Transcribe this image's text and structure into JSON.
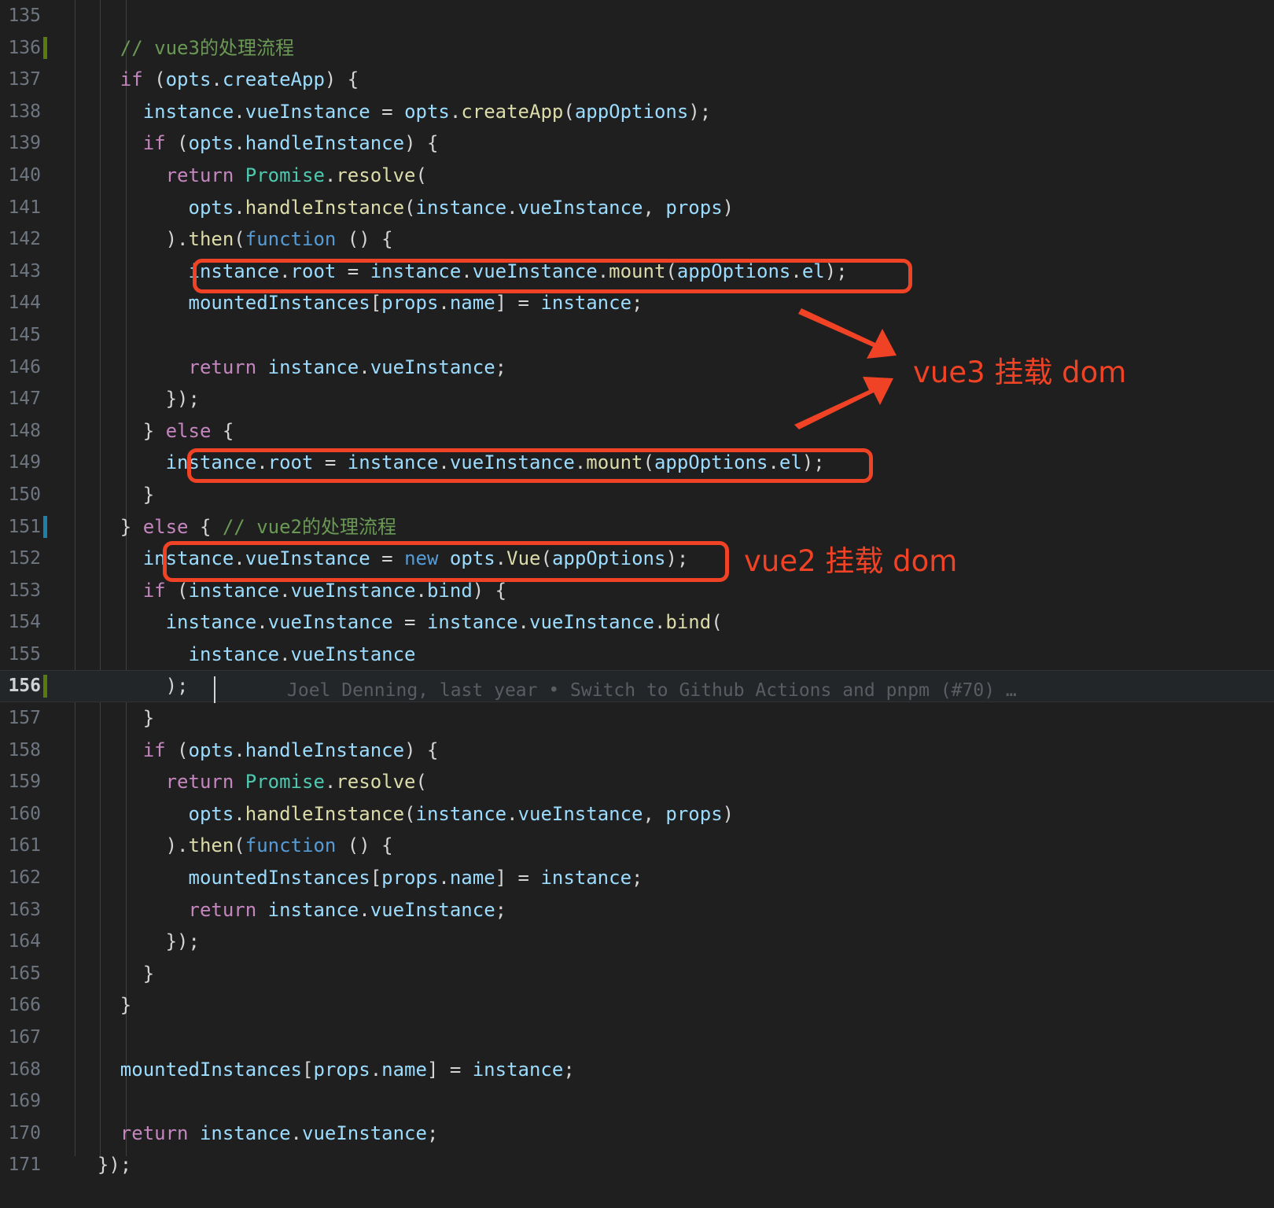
{
  "editor": {
    "theme": "dark-plus",
    "background": "#1f1f1f",
    "active_line_background": "#232629",
    "line_number_color": "#6e7681",
    "first_line": 135,
    "last_line": 171,
    "active_line": 156
  },
  "line_numbers": [
    "135",
    "136",
    "137",
    "138",
    "139",
    "140",
    "141",
    "142",
    "143",
    "144",
    "145",
    "146",
    "147",
    "148",
    "149",
    "150",
    "151",
    "152",
    "153",
    "154",
    "155",
    "156",
    "157",
    "158",
    "159",
    "160",
    "161",
    "162",
    "163",
    "164",
    "165",
    "166",
    "167",
    "168",
    "169",
    "170",
    "171"
  ],
  "code_lines": [
    {
      "n": "135",
      "text": ""
    },
    {
      "n": "136",
      "text": "    // vue3的处理流程"
    },
    {
      "n": "137",
      "text": "    if (opts.createApp) {"
    },
    {
      "n": "138",
      "text": "      instance.vueInstance = opts.createApp(appOptions);"
    },
    {
      "n": "139",
      "text": "      if (opts.handleInstance) {"
    },
    {
      "n": "140",
      "text": "        return Promise.resolve("
    },
    {
      "n": "141",
      "text": "          opts.handleInstance(instance.vueInstance, props)"
    },
    {
      "n": "142",
      "text": "        ).then(function () {"
    },
    {
      "n": "143",
      "text": "          instance.root = instance.vueInstance.mount(appOptions.el);"
    },
    {
      "n": "144",
      "text": "          mountedInstances[props.name] = instance;"
    },
    {
      "n": "145",
      "text": ""
    },
    {
      "n": "146",
      "text": "          return instance.vueInstance;"
    },
    {
      "n": "147",
      "text": "        });"
    },
    {
      "n": "148",
      "text": "      } else {"
    },
    {
      "n": "149",
      "text": "        instance.root = instance.vueInstance.mount(appOptions.el);"
    },
    {
      "n": "150",
      "text": "      }"
    },
    {
      "n": "151",
      "text": "    } else { // vue2的处理流程"
    },
    {
      "n": "152",
      "text": "      instance.vueInstance = new opts.Vue(appOptions);"
    },
    {
      "n": "153",
      "text": "      if (instance.vueInstance.bind) {"
    },
    {
      "n": "154",
      "text": "        instance.vueInstance = instance.vueInstance.bind("
    },
    {
      "n": "155",
      "text": "          instance.vueInstance"
    },
    {
      "n": "156",
      "text": "        );"
    },
    {
      "n": "157",
      "text": "      }"
    },
    {
      "n": "158",
      "text": "      if (opts.handleInstance) {"
    },
    {
      "n": "159",
      "text": "        return Promise.resolve("
    },
    {
      "n": "160",
      "text": "          opts.handleInstance(instance.vueInstance, props)"
    },
    {
      "n": "161",
      "text": "        ).then(function () {"
    },
    {
      "n": "162",
      "text": "          mountedInstances[props.name] = instance;"
    },
    {
      "n": "163",
      "text": "          return instance.vueInstance;"
    },
    {
      "n": "164",
      "text": "        });"
    },
    {
      "n": "165",
      "text": "      }"
    },
    {
      "n": "166",
      "text": "    }"
    },
    {
      "n": "167",
      "text": ""
    },
    {
      "n": "168",
      "text": "    mountedInstances[props.name] = instance;"
    },
    {
      "n": "169",
      "text": ""
    },
    {
      "n": "170",
      "text": "    return instance.vueInstance;"
    },
    {
      "n": "171",
      "text": "  });"
    }
  ],
  "tokens": {
    "l136": [
      {
        "t": "    ",
        "c": "c-plain"
      },
      {
        "t": "// vue3的处理流程",
        "c": "c-comment"
      }
    ],
    "l137": [
      {
        "t": "    ",
        "c": "c-plain"
      },
      {
        "t": "if",
        "c": "c-key"
      },
      {
        "t": " (",
        "c": "c-plain"
      },
      {
        "t": "opts",
        "c": "c-var"
      },
      {
        "t": ".",
        "c": "c-plain"
      },
      {
        "t": "createApp",
        "c": "c-var"
      },
      {
        "t": ") {",
        "c": "c-plain"
      }
    ],
    "l138": [
      {
        "t": "      ",
        "c": "c-plain"
      },
      {
        "t": "instance",
        "c": "c-var"
      },
      {
        "t": ".",
        "c": "c-plain"
      },
      {
        "t": "vueInstance",
        "c": "c-var"
      },
      {
        "t": " = ",
        "c": "c-plain"
      },
      {
        "t": "opts",
        "c": "c-var"
      },
      {
        "t": ".",
        "c": "c-plain"
      },
      {
        "t": "createApp",
        "c": "c-func"
      },
      {
        "t": "(",
        "c": "c-plain"
      },
      {
        "t": "appOptions",
        "c": "c-var"
      },
      {
        "t": ");",
        "c": "c-plain"
      }
    ],
    "l139": [
      {
        "t": "      ",
        "c": "c-plain"
      },
      {
        "t": "if",
        "c": "c-key"
      },
      {
        "t": " (",
        "c": "c-plain"
      },
      {
        "t": "opts",
        "c": "c-var"
      },
      {
        "t": ".",
        "c": "c-plain"
      },
      {
        "t": "handleInstance",
        "c": "c-var"
      },
      {
        "t": ") {",
        "c": "c-plain"
      }
    ],
    "l140": [
      {
        "t": "        ",
        "c": "c-plain"
      },
      {
        "t": "return",
        "c": "c-key"
      },
      {
        "t": " ",
        "c": "c-plain"
      },
      {
        "t": "Promise",
        "c": "c-cls"
      },
      {
        "t": ".",
        "c": "c-plain"
      },
      {
        "t": "resolve",
        "c": "c-func"
      },
      {
        "t": "(",
        "c": "c-plain"
      }
    ],
    "l141": [
      {
        "t": "          ",
        "c": "c-plain"
      },
      {
        "t": "opts",
        "c": "c-var"
      },
      {
        "t": ".",
        "c": "c-plain"
      },
      {
        "t": "handleInstance",
        "c": "c-func"
      },
      {
        "t": "(",
        "c": "c-plain"
      },
      {
        "t": "instance",
        "c": "c-var"
      },
      {
        "t": ".",
        "c": "c-plain"
      },
      {
        "t": "vueInstance",
        "c": "c-var"
      },
      {
        "t": ", ",
        "c": "c-plain"
      },
      {
        "t": "props",
        "c": "c-var"
      },
      {
        "t": ")",
        "c": "c-plain"
      }
    ],
    "l142": [
      {
        "t": "        ).",
        "c": "c-plain"
      },
      {
        "t": "then",
        "c": "c-func"
      },
      {
        "t": "(",
        "c": "c-plain"
      },
      {
        "t": "function",
        "c": "c-blue"
      },
      {
        "t": " () {",
        "c": "c-plain"
      }
    ],
    "l143": [
      {
        "t": "          ",
        "c": "c-plain"
      },
      {
        "t": "instance",
        "c": "c-var"
      },
      {
        "t": ".",
        "c": "c-plain"
      },
      {
        "t": "root",
        "c": "c-var"
      },
      {
        "t": " = ",
        "c": "c-plain"
      },
      {
        "t": "instance",
        "c": "c-var"
      },
      {
        "t": ".",
        "c": "c-plain"
      },
      {
        "t": "vueInstance",
        "c": "c-var"
      },
      {
        "t": ".",
        "c": "c-plain"
      },
      {
        "t": "mount",
        "c": "c-func"
      },
      {
        "t": "(",
        "c": "c-plain"
      },
      {
        "t": "appOptions",
        "c": "c-var"
      },
      {
        "t": ".",
        "c": "c-plain"
      },
      {
        "t": "el",
        "c": "c-var"
      },
      {
        "t": ");",
        "c": "c-plain"
      }
    ],
    "l144": [
      {
        "t": "          ",
        "c": "c-plain"
      },
      {
        "t": "mountedInstances",
        "c": "c-var"
      },
      {
        "t": "[",
        "c": "c-plain"
      },
      {
        "t": "props",
        "c": "c-var"
      },
      {
        "t": ".",
        "c": "c-plain"
      },
      {
        "t": "name",
        "c": "c-var"
      },
      {
        "t": "] = ",
        "c": "c-plain"
      },
      {
        "t": "instance",
        "c": "c-var"
      },
      {
        "t": ";",
        "c": "c-plain"
      }
    ],
    "l146": [
      {
        "t": "          ",
        "c": "c-plain"
      },
      {
        "t": "return",
        "c": "c-key"
      },
      {
        "t": " ",
        "c": "c-plain"
      },
      {
        "t": "instance",
        "c": "c-var"
      },
      {
        "t": ".",
        "c": "c-plain"
      },
      {
        "t": "vueInstance",
        "c": "c-var"
      },
      {
        "t": ";",
        "c": "c-plain"
      }
    ],
    "l147": [
      {
        "t": "        });",
        "c": "c-plain"
      }
    ],
    "l148": [
      {
        "t": "      } ",
        "c": "c-plain"
      },
      {
        "t": "else",
        "c": "c-key"
      },
      {
        "t": " {",
        "c": "c-plain"
      }
    ],
    "l149": [
      {
        "t": "        ",
        "c": "c-plain"
      },
      {
        "t": "instance",
        "c": "c-var"
      },
      {
        "t": ".",
        "c": "c-plain"
      },
      {
        "t": "root",
        "c": "c-var"
      },
      {
        "t": " = ",
        "c": "c-plain"
      },
      {
        "t": "instance",
        "c": "c-var"
      },
      {
        "t": ".",
        "c": "c-plain"
      },
      {
        "t": "vueInstance",
        "c": "c-var"
      },
      {
        "t": ".",
        "c": "c-plain"
      },
      {
        "t": "mount",
        "c": "c-func"
      },
      {
        "t": "(",
        "c": "c-plain"
      },
      {
        "t": "appOptions",
        "c": "c-var"
      },
      {
        "t": ".",
        "c": "c-plain"
      },
      {
        "t": "el",
        "c": "c-var"
      },
      {
        "t": ");",
        "c": "c-plain"
      }
    ],
    "l150": [
      {
        "t": "      }",
        "c": "c-plain"
      }
    ],
    "l151": [
      {
        "t": "    } ",
        "c": "c-plain"
      },
      {
        "t": "else",
        "c": "c-key"
      },
      {
        "t": " { ",
        "c": "c-plain"
      },
      {
        "t": "// vue2的处理流程",
        "c": "c-comment"
      }
    ],
    "l152": [
      {
        "t": "      ",
        "c": "c-plain"
      },
      {
        "t": "instance",
        "c": "c-var"
      },
      {
        "t": ".",
        "c": "c-plain"
      },
      {
        "t": "vueInstance",
        "c": "c-var"
      },
      {
        "t": " = ",
        "c": "c-plain"
      },
      {
        "t": "new",
        "c": "c-blue"
      },
      {
        "t": " ",
        "c": "c-plain"
      },
      {
        "t": "opts",
        "c": "c-var"
      },
      {
        "t": ".",
        "c": "c-plain"
      },
      {
        "t": "Vue",
        "c": "c-func"
      },
      {
        "t": "(",
        "c": "c-plain"
      },
      {
        "t": "appOptions",
        "c": "c-var"
      },
      {
        "t": ");",
        "c": "c-plain"
      }
    ],
    "l153": [
      {
        "t": "      ",
        "c": "c-plain"
      },
      {
        "t": "if",
        "c": "c-key"
      },
      {
        "t": " (",
        "c": "c-plain"
      },
      {
        "t": "instance",
        "c": "c-var"
      },
      {
        "t": ".",
        "c": "c-plain"
      },
      {
        "t": "vueInstance",
        "c": "c-var"
      },
      {
        "t": ".",
        "c": "c-plain"
      },
      {
        "t": "bind",
        "c": "c-var"
      },
      {
        "t": ") {",
        "c": "c-plain"
      }
    ],
    "l154": [
      {
        "t": "        ",
        "c": "c-plain"
      },
      {
        "t": "instance",
        "c": "c-var"
      },
      {
        "t": ".",
        "c": "c-plain"
      },
      {
        "t": "vueInstance",
        "c": "c-var"
      },
      {
        "t": " = ",
        "c": "c-plain"
      },
      {
        "t": "instance",
        "c": "c-var"
      },
      {
        "t": ".",
        "c": "c-plain"
      },
      {
        "t": "vueInstance",
        "c": "c-var"
      },
      {
        "t": ".",
        "c": "c-plain"
      },
      {
        "t": "bind",
        "c": "c-func"
      },
      {
        "t": "(",
        "c": "c-plain"
      }
    ],
    "l155": [
      {
        "t": "          ",
        "c": "c-plain"
      },
      {
        "t": "instance",
        "c": "c-var"
      },
      {
        "t": ".",
        "c": "c-plain"
      },
      {
        "t": "vueInstance",
        "c": "c-var"
      }
    ],
    "l156": [
      {
        "t": "        );",
        "c": "c-plain"
      }
    ],
    "l157": [
      {
        "t": "      }",
        "c": "c-plain"
      }
    ],
    "l158": [
      {
        "t": "      ",
        "c": "c-plain"
      },
      {
        "t": "if",
        "c": "c-key"
      },
      {
        "t": " (",
        "c": "c-plain"
      },
      {
        "t": "opts",
        "c": "c-var"
      },
      {
        "t": ".",
        "c": "c-plain"
      },
      {
        "t": "handleInstance",
        "c": "c-var"
      },
      {
        "t": ") {",
        "c": "c-plain"
      }
    ],
    "l159": [
      {
        "t": "        ",
        "c": "c-plain"
      },
      {
        "t": "return",
        "c": "c-key"
      },
      {
        "t": " ",
        "c": "c-plain"
      },
      {
        "t": "Promise",
        "c": "c-cls"
      },
      {
        "t": ".",
        "c": "c-plain"
      },
      {
        "t": "resolve",
        "c": "c-func"
      },
      {
        "t": "(",
        "c": "c-plain"
      }
    ],
    "l160": [
      {
        "t": "          ",
        "c": "c-plain"
      },
      {
        "t": "opts",
        "c": "c-var"
      },
      {
        "t": ".",
        "c": "c-plain"
      },
      {
        "t": "handleInstance",
        "c": "c-func"
      },
      {
        "t": "(",
        "c": "c-plain"
      },
      {
        "t": "instance",
        "c": "c-var"
      },
      {
        "t": ".",
        "c": "c-plain"
      },
      {
        "t": "vueInstance",
        "c": "c-var"
      },
      {
        "t": ", ",
        "c": "c-plain"
      },
      {
        "t": "props",
        "c": "c-var"
      },
      {
        "t": ")",
        "c": "c-plain"
      }
    ],
    "l161": [
      {
        "t": "        ).",
        "c": "c-plain"
      },
      {
        "t": "then",
        "c": "c-func"
      },
      {
        "t": "(",
        "c": "c-plain"
      },
      {
        "t": "function",
        "c": "c-blue"
      },
      {
        "t": " () {",
        "c": "c-plain"
      }
    ],
    "l162": [
      {
        "t": "          ",
        "c": "c-plain"
      },
      {
        "t": "mountedInstances",
        "c": "c-var"
      },
      {
        "t": "[",
        "c": "c-plain"
      },
      {
        "t": "props",
        "c": "c-var"
      },
      {
        "t": ".",
        "c": "c-plain"
      },
      {
        "t": "name",
        "c": "c-var"
      },
      {
        "t": "] = ",
        "c": "c-plain"
      },
      {
        "t": "instance",
        "c": "c-var"
      },
      {
        "t": ";",
        "c": "c-plain"
      }
    ],
    "l163": [
      {
        "t": "          ",
        "c": "c-plain"
      },
      {
        "t": "return",
        "c": "c-key"
      },
      {
        "t": " ",
        "c": "c-plain"
      },
      {
        "t": "instance",
        "c": "c-var"
      },
      {
        "t": ".",
        "c": "c-plain"
      },
      {
        "t": "vueInstance",
        "c": "c-var"
      },
      {
        "t": ";",
        "c": "c-plain"
      }
    ],
    "l164": [
      {
        "t": "        });",
        "c": "c-plain"
      }
    ],
    "l165": [
      {
        "t": "      }",
        "c": "c-plain"
      }
    ],
    "l166": [
      {
        "t": "    }",
        "c": "c-plain"
      }
    ],
    "l168": [
      {
        "t": "    ",
        "c": "c-plain"
      },
      {
        "t": "mountedInstances",
        "c": "c-var"
      },
      {
        "t": "[",
        "c": "c-plain"
      },
      {
        "t": "props",
        "c": "c-var"
      },
      {
        "t": ".",
        "c": "c-plain"
      },
      {
        "t": "name",
        "c": "c-var"
      },
      {
        "t": "] = ",
        "c": "c-plain"
      },
      {
        "t": "instance",
        "c": "c-var"
      },
      {
        "t": ";",
        "c": "c-plain"
      }
    ],
    "l170": [
      {
        "t": "    ",
        "c": "c-plain"
      },
      {
        "t": "return",
        "c": "c-key"
      },
      {
        "t": " ",
        "c": "c-plain"
      },
      {
        "t": "instance",
        "c": "c-var"
      },
      {
        "t": ".",
        "c": "c-plain"
      },
      {
        "t": "vueInstance",
        "c": "c-var"
      },
      {
        "t": ";",
        "c": "c-plain"
      }
    ],
    "l171": [
      {
        "t": "  });",
        "c": "c-plain"
      }
    ]
  },
  "git_blame": {
    "line": "156",
    "text": "Joel Denning, last year • Switch to Github Actions and pnpm (#70) …"
  },
  "annotations": {
    "color": "#f04225",
    "labels": [
      {
        "id": "vue3",
        "text": "vue3 挂载 dom"
      },
      {
        "id": "vue2",
        "text": "vue2 挂载 dom"
      }
    ],
    "boxes": [
      {
        "id": "box-line-143",
        "target_line": "143"
      },
      {
        "id": "box-line-149",
        "target_line": "149"
      },
      {
        "id": "box-line-152",
        "target_line": "152"
      }
    ],
    "arrows": [
      {
        "id": "arrow-to-line-143"
      },
      {
        "id": "arrow-to-line-149"
      }
    ]
  },
  "gutter_markers": [
    {
      "line": "136",
      "type": "added",
      "color": "#587c0c"
    },
    {
      "line": "151",
      "type": "modified",
      "color": "#1b81a8"
    },
    {
      "line": "156",
      "type": "added",
      "color": "#587c0c"
    }
  ]
}
